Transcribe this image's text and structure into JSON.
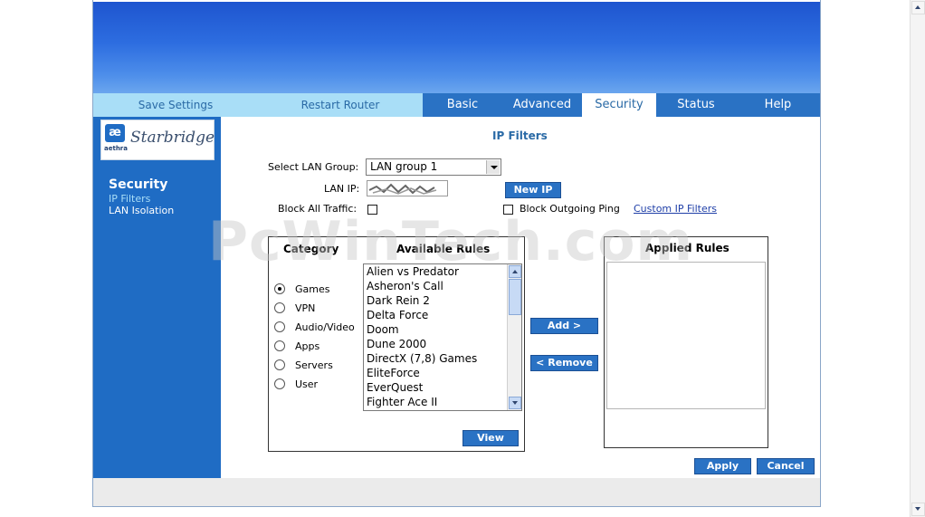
{
  "nav": {
    "save_settings": "Save Settings",
    "restart_router": "Restart Router",
    "tabs": [
      "Basic",
      "Advanced",
      "Security",
      "Status",
      "Help"
    ],
    "active_tab": "Security"
  },
  "sidebar": {
    "logo_mark": "æ",
    "logo_sub": "aethra",
    "logo_script": "Starbridge",
    "section_title": "Security",
    "items": [
      "IP Filters",
      "LAN Isolation"
    ]
  },
  "main": {
    "page_title": "IP Filters",
    "lan_group_label": "Select LAN Group:",
    "lan_group_value": "LAN group 1",
    "lan_ip_label": "LAN IP:",
    "new_ip_button": "New IP",
    "block_all_label": "Block All Traffic:",
    "block_ping_label": "Block Outgoing Ping",
    "custom_filters_link": "Custom IP Filters"
  },
  "category": {
    "header": "Category",
    "options": [
      "Games",
      "VPN",
      "Audio/Video",
      "Apps",
      "Servers",
      "User"
    ],
    "selected": "Games"
  },
  "available": {
    "header": "Available Rules",
    "items": [
      "Alien vs Predator",
      "Asheron's Call",
      "Dark Rein 2",
      "Delta Force",
      "Doom",
      "Dune 2000",
      "DirectX (7,8) Games",
      "EliteForce",
      "EverQuest",
      "Fighter Ace II"
    ],
    "view_button": "View"
  },
  "applied": {
    "header": "Applied Rules",
    "items": []
  },
  "actions": {
    "add": "Add >",
    "remove": "< Remove",
    "apply": "Apply",
    "cancel": "Cancel"
  },
  "watermark": "PcWinTech.com",
  "colors": {
    "accent": "#2a72c4",
    "nav_light": "#a9def7",
    "link": "#1f3fa8"
  }
}
